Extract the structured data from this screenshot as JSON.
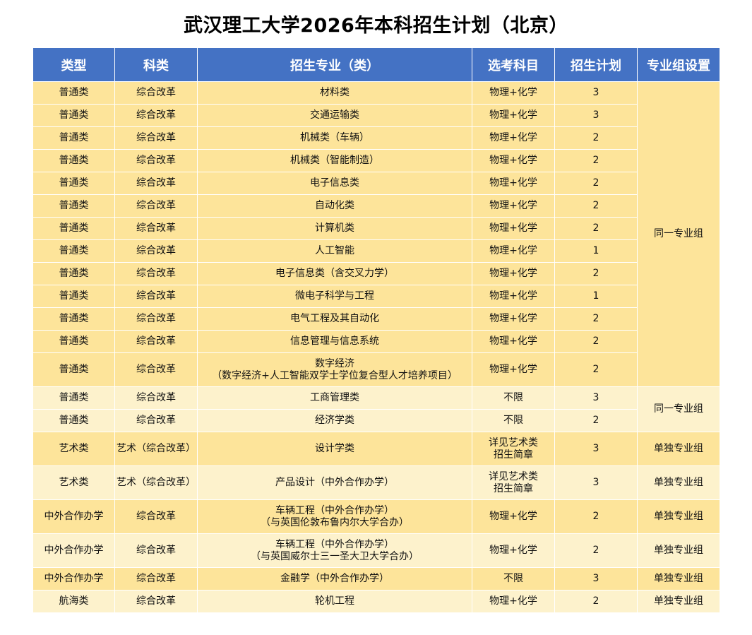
{
  "title": "武汉理工大学2026年本科招生计划（北京）",
  "headers": [
    "类型",
    "科类",
    "招生专业（类）",
    "选考科目",
    "招生计划",
    "专业组设置"
  ],
  "rows": [
    {
      "type": "普通类",
      "category": "综合改革",
      "major": [
        "材料类"
      ],
      "subjects": [
        "物理+化学"
      ],
      "plan": "3"
    },
    {
      "type": "普通类",
      "category": "综合改革",
      "major": [
        "交通运输类"
      ],
      "subjects": [
        "物理+化学"
      ],
      "plan": "3"
    },
    {
      "type": "普通类",
      "category": "综合改革",
      "major": [
        "机械类（车辆）"
      ],
      "subjects": [
        "物理+化学"
      ],
      "plan": "2"
    },
    {
      "type": "普通类",
      "category": "综合改革",
      "major": [
        "机械类（智能制造）"
      ],
      "subjects": [
        "物理+化学"
      ],
      "plan": "2"
    },
    {
      "type": "普通类",
      "category": "综合改革",
      "major": [
        "电子信息类"
      ],
      "subjects": [
        "物理+化学"
      ],
      "plan": "2"
    },
    {
      "type": "普通类",
      "category": "综合改革",
      "major": [
        "自动化类"
      ],
      "subjects": [
        "物理+化学"
      ],
      "plan": "2"
    },
    {
      "type": "普通类",
      "category": "综合改革",
      "major": [
        "计算机类"
      ],
      "subjects": [
        "物理+化学"
      ],
      "plan": "2"
    },
    {
      "type": "普通类",
      "category": "综合改革",
      "major": [
        "人工智能"
      ],
      "subjects": [
        "物理+化学"
      ],
      "plan": "1"
    },
    {
      "type": "普通类",
      "category": "综合改革",
      "major": [
        "电子信息类（含交叉力学）"
      ],
      "subjects": [
        "物理+化学"
      ],
      "plan": "2"
    },
    {
      "type": "普通类",
      "category": "综合改革",
      "major": [
        "微电子科学与工程"
      ],
      "subjects": [
        "物理+化学"
      ],
      "plan": "1"
    },
    {
      "type": "普通类",
      "category": "综合改革",
      "major": [
        "电气工程及其自动化"
      ],
      "subjects": [
        "物理+化学"
      ],
      "plan": "2"
    },
    {
      "type": "普通类",
      "category": "综合改革",
      "major": [
        "信息管理与信息系统"
      ],
      "subjects": [
        "物理+化学"
      ],
      "plan": "2"
    },
    {
      "type": "普通类",
      "category": "综合改革",
      "major": [
        "数字经济",
        "（数字经济+人工智能双学士学位复合型人才培养项目）"
      ],
      "subjects": [
        "物理+化学"
      ],
      "plan": "2"
    },
    {
      "type": "普通类",
      "category": "综合改革",
      "major": [
        "工商管理类"
      ],
      "subjects": [
        "不限"
      ],
      "plan": "3"
    },
    {
      "type": "普通类",
      "category": "综合改革",
      "major": [
        "经济学类"
      ],
      "subjects": [
        "不限"
      ],
      "plan": "2"
    },
    {
      "type": "艺术类",
      "category": "艺术（综合改革）",
      "major": [
        "设计学类"
      ],
      "subjects": [
        "详见艺术类",
        "招生简章"
      ],
      "plan": "3"
    },
    {
      "type": "艺术类",
      "category": "艺术（综合改革）",
      "major": [
        "产品设计（中外合作办学）"
      ],
      "subjects": [
        "详见艺术类",
        "招生简章"
      ],
      "plan": "3"
    },
    {
      "type": "中外合作办学",
      "category": "综合改革",
      "major": [
        "车辆工程（中外合作办学）",
        "（与英国伦敦布鲁内尔大学合办）"
      ],
      "subjects": [
        "物理+化学"
      ],
      "plan": "2"
    },
    {
      "type": "中外合作办学",
      "category": "综合改革",
      "major": [
        "车辆工程（中外合作办学）",
        "（与英国威尔士三一圣大卫大学合办）"
      ],
      "subjects": [
        "物理+化学"
      ],
      "plan": "2"
    },
    {
      "type": "中外合作办学",
      "category": "综合改革",
      "major": [
        "金融学（中外合作办学）"
      ],
      "subjects": [
        "不限"
      ],
      "plan": "3"
    },
    {
      "type": "航海类",
      "category": "综合改革",
      "major": [
        "轮机工程"
      ],
      "subjects": [
        "物理+化学"
      ],
      "plan": "2"
    }
  ],
  "groups": [
    {
      "label": "同一专业组"
    },
    {
      "label": "同一专业组"
    },
    {
      "label": "单独专业组"
    },
    {
      "label": "单独专业组"
    },
    {
      "label": "单独专业组"
    },
    {
      "label": "单独专业组"
    },
    {
      "label": "单独专业组"
    },
    {
      "label": "单独专业组"
    }
  ],
  "colors": {
    "header_bg": "#4472c4",
    "header_text": "#ffffff",
    "band_dark": "#fde49a",
    "band_light": "#fdf2cc"
  }
}
